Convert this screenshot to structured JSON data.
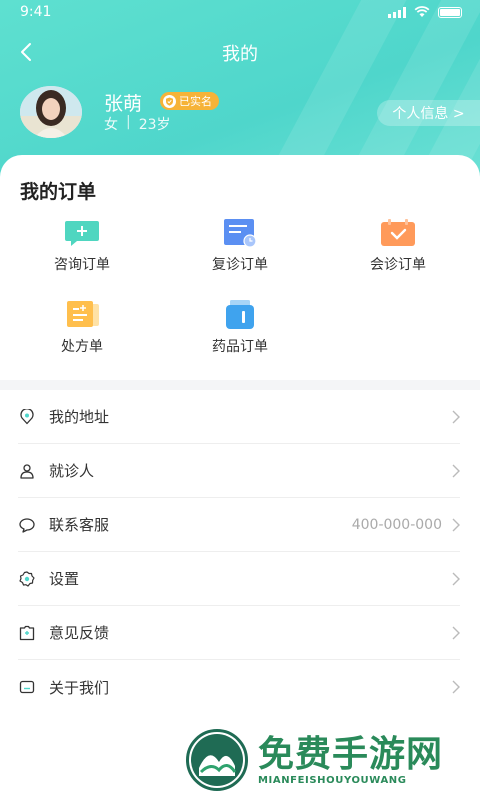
{
  "status_bar": {
    "time": "9:41"
  },
  "nav": {
    "title": "我的"
  },
  "profile": {
    "name": "张萌",
    "verified_badge": "已实名",
    "gender": "女",
    "separator": "|",
    "age": "23岁",
    "info_button": "个人信息 >"
  },
  "orders": {
    "title": "我的订单",
    "items": [
      {
        "label": "咨询订单",
        "icon": "consult-order-icon"
      },
      {
        "label": "复诊订单",
        "icon": "revisit-order-icon"
      },
      {
        "label": "会诊订单",
        "icon": "consultation-order-icon"
      },
      {
        "label": "处方单",
        "icon": "prescription-icon"
      },
      {
        "label": "药品订单",
        "icon": "medicine-order-icon"
      }
    ]
  },
  "menu": {
    "items": [
      {
        "label": "我的地址",
        "value": "",
        "icon": "location-icon"
      },
      {
        "label": "就诊人",
        "value": "",
        "icon": "person-icon"
      },
      {
        "label": "联系客服",
        "value": "400-000-000",
        "icon": "chat-icon"
      },
      {
        "label": "设置",
        "value": "",
        "icon": "gear-icon"
      },
      {
        "label": "意见反馈",
        "value": "",
        "icon": "feedback-icon"
      },
      {
        "label": "关于我们",
        "value": "",
        "icon": "info-icon"
      }
    ]
  },
  "watermark": {
    "title": "免费手游网",
    "subtitle": "MIANFEISHOUYOUWANG"
  },
  "colors": {
    "accent": "#4fd6cb",
    "badge": "#f6b338",
    "watermark": "#2a8a5a"
  }
}
